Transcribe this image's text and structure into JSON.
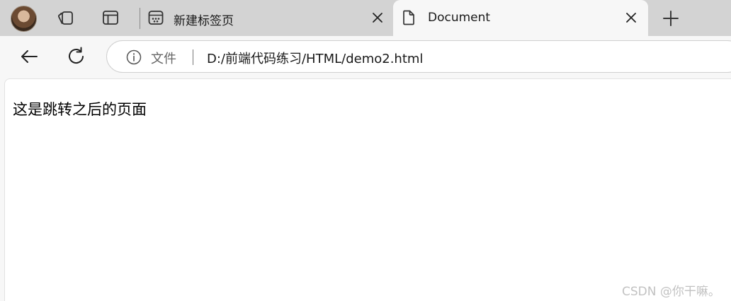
{
  "tabs": [
    {
      "title": "新建标签页",
      "favicon": "new-tab-grid-icon",
      "active": false
    },
    {
      "title": "Document",
      "favicon": "document-icon",
      "active": true
    }
  ],
  "toolbar": {
    "scheme_label": "文件",
    "url": "D:/前端代码练习/HTML/demo2.html"
  },
  "content": {
    "text": "这是跳转之后的页面"
  },
  "watermark": "CSDN @你干嘛。",
  "colors": {
    "tabstrip_bg": "#d3d3d3",
    "active_tab_bg": "#f7f7f7",
    "content_bg": "#ffffff"
  }
}
